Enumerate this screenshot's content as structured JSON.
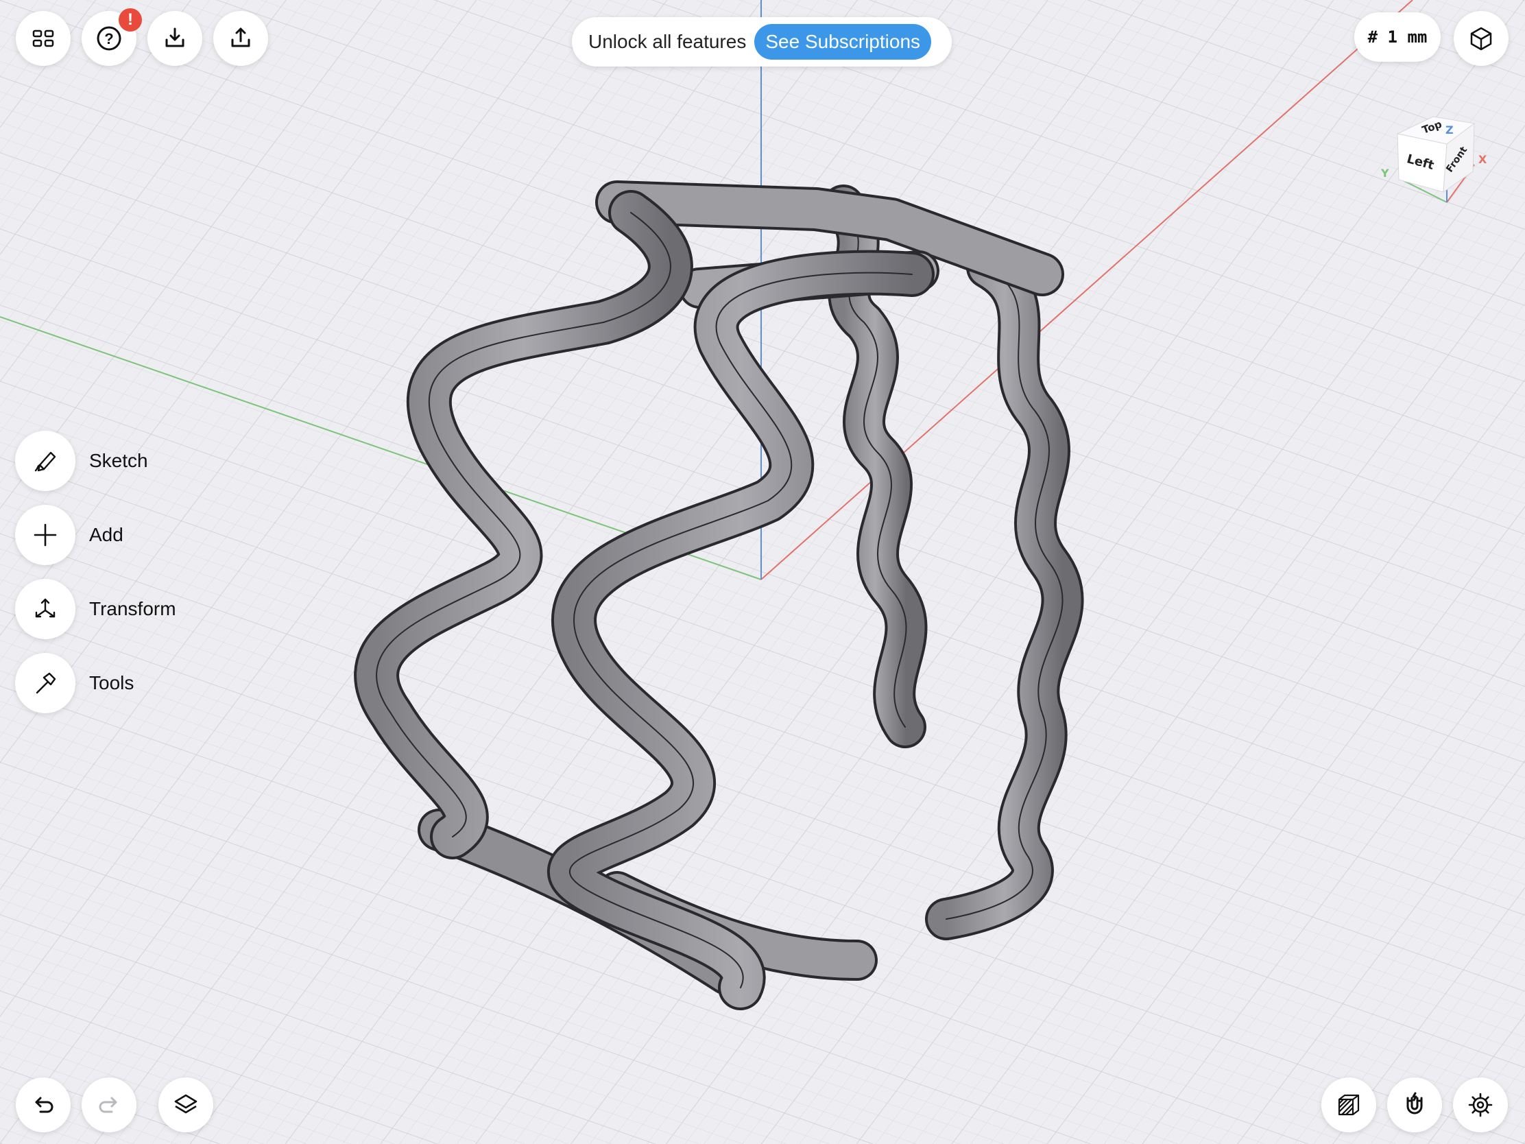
{
  "toolbar": {
    "grid_icon": "grid-icon",
    "help_icon": "question-icon",
    "help_badge": "!",
    "import_icon": "download-tray-icon",
    "export_icon": "upload-tray-icon"
  },
  "promo": {
    "text": "Unlock all features",
    "button_label": "See Subscriptions",
    "accent": "#3d97e8"
  },
  "grid_setting": {
    "label": "# 1 mm"
  },
  "view_cube": {
    "top": "Top",
    "left": "Left",
    "front": "Front",
    "x": "X",
    "y": "Y",
    "z": "Z"
  },
  "menu": [
    {
      "label": "Sketch",
      "icon": "pencil-icon"
    },
    {
      "label": "Add",
      "icon": "plus-icon"
    },
    {
      "label": "Transform",
      "icon": "transform-arrows-icon"
    },
    {
      "label": "Tools",
      "icon": "hammer-icon"
    }
  ],
  "bottom_bar": {
    "undo_icon": "undo-icon",
    "redo_icon": "redo-icon",
    "layers_icon": "layers-icon",
    "material_icon": "hatched-cube-icon",
    "snap_icon": "magnet-icon",
    "settings_icon": "gear-icon"
  },
  "colors": {
    "x_axis": "#e0736a",
    "y_axis": "#7cc47a",
    "z_axis": "#5a8fe0",
    "background": "#eeedf1",
    "badge": "#e84a3b"
  }
}
